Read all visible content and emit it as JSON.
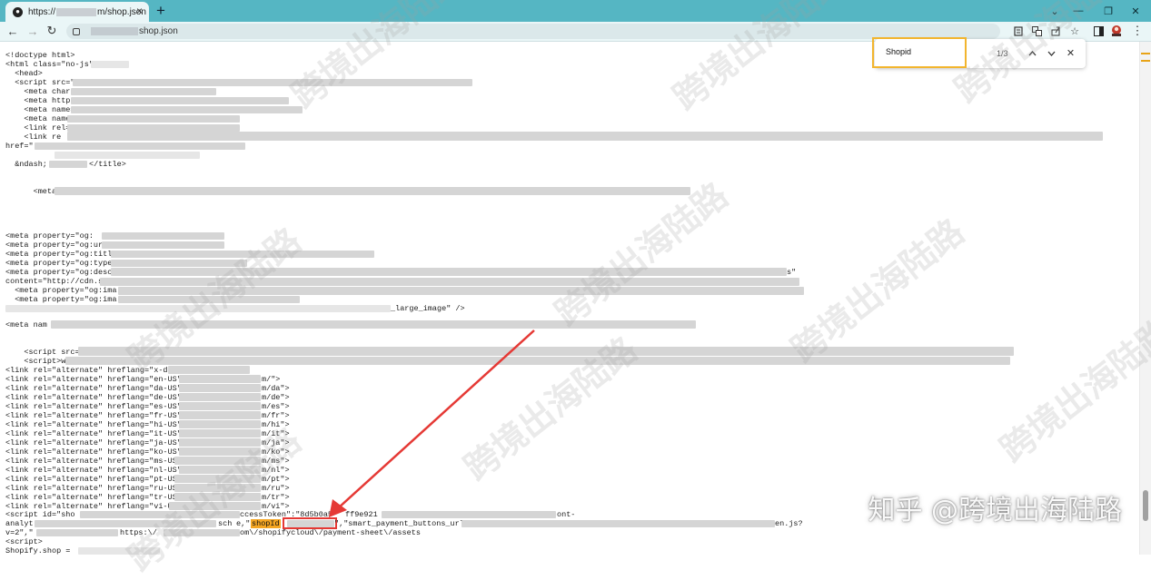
{
  "browser": {
    "tab": {
      "title_prefix": "https://",
      "title_suffix": "m/shop.json",
      "close_glyph": "×"
    },
    "new_tab_glyph": "+",
    "window_controls": [
      "⌄",
      "—",
      "❐",
      "✕"
    ],
    "nav": {
      "back": "←",
      "forward": "→",
      "reload": "↻"
    },
    "address": {
      "url_visible": "shop.json"
    },
    "icons": [
      "translate-icon",
      "share-icon",
      "star-icon",
      "sidebar-icon",
      "profile-icon",
      "menu-icon"
    ]
  },
  "find_bar": {
    "query": "Shopid",
    "count": "1/3",
    "prev": "⌃",
    "next": "⌄",
    "close": "✕"
  },
  "source": {
    "lines": {
      "l1": "<!doctype html>",
      "l2": "<html class=\"no-js\"",
      "l3": "  <head>",
      "l4": "  <script src=\"",
      "l5": "    <meta chars",
      "l6": "    <meta http-",
      "l7": "    <meta name=\"",
      "l8": "    <meta name",
      "l9": "    <link rel=",
      "l10": "    <link re",
      "l11": "href=\"",
      "l12": "  &ndash;",
      "l12b": "</title>",
      "l13": "      <meta",
      "og1": "<meta property=\"og:",
      "og2": "<meta property=\"og:ur",
      "og3": "<meta property=\"og:title",
      "og4": "<meta property=\"og:type",
      "og5": "<meta property=\"og:desc",
      "og5b": "s\"",
      "content1": "content=\"http://cdn.s",
      "og6": "  <meta property=\"og:ima",
      "og7": "  <meta property=\"og:ima",
      "og8b": "_large_image\" />",
      "metanam": "<meta nam",
      "script1": "    <script src=\"/",
      "script2": "    <script>wi",
      "alt0": "<link rel=\"alternate\" hreflang=\"x-default\"",
      "alt_en": "<link rel=\"alternate\" hreflang=\"en-US\" hre",
      "alt_da": "<link rel=\"alternate\" hreflang=\"da-US\" hre",
      "alt_de": "<link rel=\"alternate\" hreflang=\"de-US\" hre",
      "alt_es": "<link rel=\"alternate\" hreflang=\"es-US\" hre",
      "alt_fr": "<link rel=\"alternate\" hreflang=\"fr-US\" hre",
      "alt_hi": "<link rel=\"alternate\" hreflang=\"hi-US\" hre",
      "alt_it": "<link rel=\"alternate\" hreflang=\"it-US\" hre",
      "alt_ja": "<link rel=\"alternate\" hreflang=\"ja-US\" hre",
      "alt_ko": "<link rel=\"alternate\" hreflang=\"ko-US\" hre",
      "alt_ms": "<link rel=\"alternate\" hreflang=\"ms-US\" hr",
      "alt_nl": "<link rel=\"alternate\" hreflang=\"nl-US\" hre",
      "alt_pt": "<link rel=\"alternate\" hreflang=\"pt-US\" hr",
      "alt_ru": "<link rel=\"alternate\" hreflang=\"ru-US\" hr",
      "alt_tr": "<link rel=\"alternate\" hreflang=\"tr-US\" hr",
      "alt_vi": "<link rel=\"alternate\" hreflang=\"vi-US\" h",
      "end_en": "m/\">",
      "end_da": "m/da\">",
      "end_de": "m/de\">",
      "end_es": "m/es\">",
      "end_fr": "m/fr\">",
      "end_hi": "m/hi\">",
      "end_it": "m/it\">",
      "end_ja": "m/ja\">",
      "end_ko": "m/ko\">",
      "end_ms": "m/ms\">",
      "end_nl": "m/nl\">",
      "end_pt": "m/pt\">",
      "end_ru": "m/ru\">",
      "end_tr": "m/tr\">",
      "end_vi": "m/vi\">",
      "sc_id": "<script id=\"sho",
      "sc_token": "ccessToken\":\"8d5b0a5",
      "sc_token2": "ff9e921",
      "sc_ont": "ont-",
      "analyt": "analyt",
      "sch": "sch",
      "e_quote": "e,\"",
      "shopid_match": "shopId",
      "after_match": "\",\"smart_payment_buttons_url\":\"",
      "enjs": "en.js?",
      "vline": "v=2\",\"",
      "https": "https:\\/",
      "payment": "om\\/shopifycloud\\/payment-sheet\\/assets",
      "script_close": "<script>",
      "shopify": "Shopify.shop = "
    }
  },
  "watermark_text": "跨境出海陆路",
  "credit": "知乎 @跨境出海陆路"
}
